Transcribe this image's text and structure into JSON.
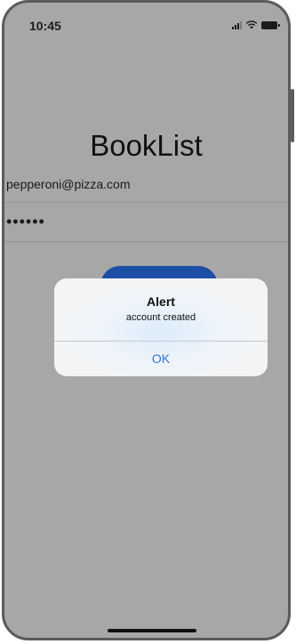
{
  "status_bar": {
    "time": "10:45",
    "icons": [
      "signal-icon",
      "wifi-icon",
      "battery-icon"
    ]
  },
  "screen": {
    "title": "BookList",
    "email_value": "pepperoni@pizza.com",
    "password_value": "••••••"
  },
  "alert": {
    "title": "Alert",
    "message": "account created",
    "ok_label": "OK"
  },
  "colors": {
    "overlay": "#a7a7a7",
    "button": "#1e4fa6",
    "alert_action": "#2f74e0"
  }
}
